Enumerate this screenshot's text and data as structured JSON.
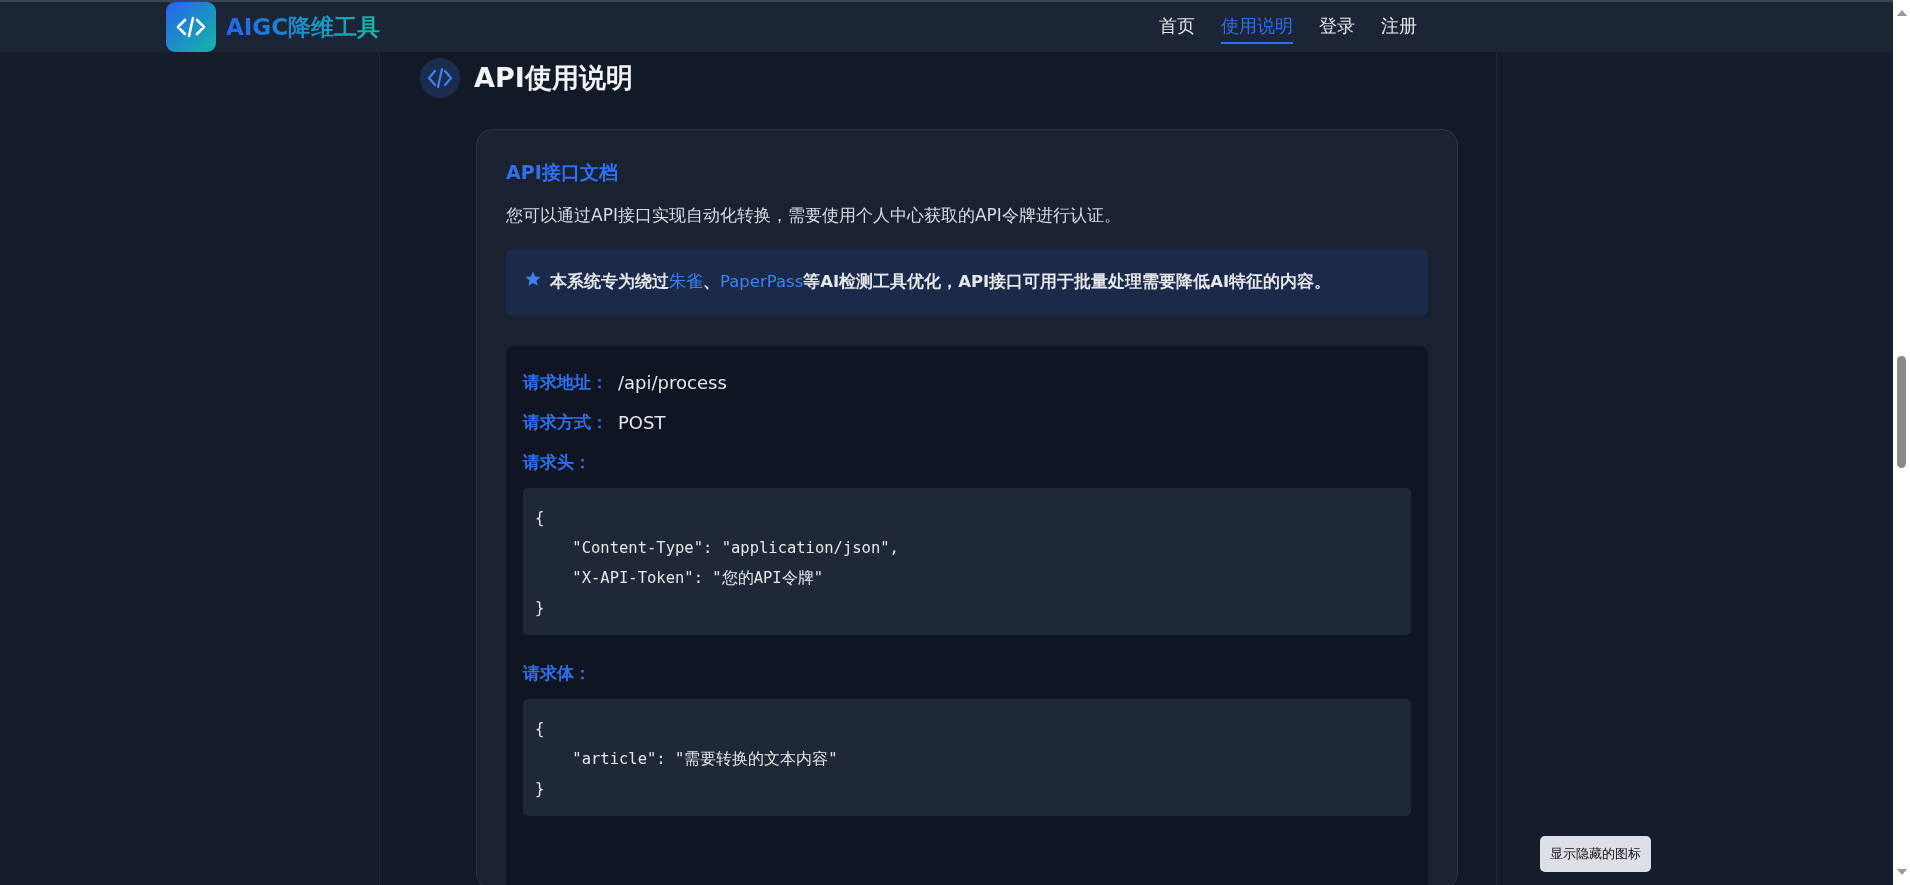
{
  "header": {
    "brand": "AIGC降维工具",
    "nav": [
      {
        "label": "首页",
        "selected": false
      },
      {
        "label": "使用说明",
        "selected": true
      },
      {
        "label": "登录",
        "selected": false
      },
      {
        "label": "注册",
        "selected": false
      }
    ]
  },
  "section": {
    "title": "API使用说明"
  },
  "card": {
    "title": "API接口文档",
    "intro": "您可以通过API接口实现自动化转换，需要使用个人中心获取的API令牌进行认证。",
    "note": [
      {
        "kind": "text",
        "text": "本系统专为绕过"
      },
      {
        "kind": "link",
        "text": "朱雀"
      },
      {
        "kind": "text",
        "text": "、"
      },
      {
        "kind": "link",
        "text": "PaperPass"
      },
      {
        "kind": "text",
        "text": "等AI检测工具优化，API接口可用于批量处理需要降低AI特征的内容。"
      }
    ],
    "fields": [
      {
        "label": "请求地址：",
        "value": "/api/process"
      },
      {
        "label": "请求方式：",
        "value": "POST"
      }
    ],
    "blocks": [
      {
        "label": "请求头：",
        "lines": [
          "{",
          "    \"Content-Type\": \"application/json\",",
          "    \"X-API-Token\": \"您的API令牌\"",
          "}"
        ]
      },
      {
        "label": "请求体：",
        "lines": [
          "{",
          "    \"article\": \"需要转换的文本内容\"",
          "}"
        ]
      }
    ]
  },
  "tooltip": "显示隐藏的图标"
}
